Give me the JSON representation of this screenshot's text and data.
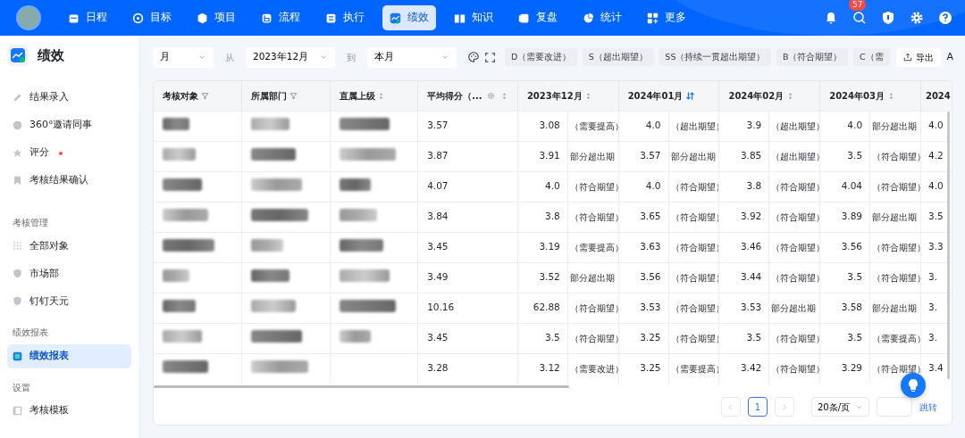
{
  "nav": {
    "items": [
      {
        "label": "日程",
        "selected": false
      },
      {
        "label": "目标",
        "selected": false
      },
      {
        "label": "项目",
        "selected": false
      },
      {
        "label": "流程",
        "selected": false
      },
      {
        "label": "执行",
        "selected": false
      },
      {
        "label": "绩效",
        "selected": true
      },
      {
        "label": "知识",
        "selected": false
      },
      {
        "label": "复盘",
        "selected": false
      },
      {
        "label": "统计",
        "selected": false
      },
      {
        "label": "更多",
        "selected": false
      }
    ],
    "notification_count": "57"
  },
  "sidebar": {
    "title": "绩效",
    "groups": [
      {
        "items": [
          {
            "label": "结果录入",
            "selected": false,
            "dot": false
          },
          {
            "label": "360°邀请同事",
            "selected": false,
            "dot": false
          },
          {
            "label": "评分",
            "selected": false,
            "dot": true
          },
          {
            "label": "考核结果确认",
            "selected": false,
            "dot": false
          }
        ]
      },
      {
        "heading": "考核管理",
        "items": [
          {
            "label": "全部对象",
            "selected": false,
            "dot": false
          },
          {
            "label": "市场部",
            "selected": false,
            "dot": false
          },
          {
            "label": "钉钉天元",
            "selected": false,
            "dot": false
          }
        ]
      },
      {
        "heading": "绩效报表",
        "items": [
          {
            "label": "绩效报表",
            "selected": true,
            "dot": false
          }
        ]
      },
      {
        "heading": "设置",
        "items": [
          {
            "label": "考核模板",
            "selected": false,
            "dot": false
          }
        ]
      }
    ]
  },
  "toolbar": {
    "period": "月",
    "from_label": "从",
    "from": "2023年12月",
    "to_label": "到",
    "to": "本月",
    "legend": [
      "D（需要改进）",
      "S（超出期望）",
      "SS（持续一贯超出期望）",
      "B（符合期望）",
      "C（需"
    ],
    "export": "导出",
    "cut_text": "A"
  },
  "table": {
    "columns": [
      {
        "label": "考核对象",
        "kind": "filter",
        "active": false
      },
      {
        "label": "所属部门",
        "kind": "filter",
        "active": false
      },
      {
        "label": "直属上级",
        "kind": "sort",
        "active": false
      },
      {
        "label": "平均得分（...",
        "kind": "settings",
        "active": false
      },
      {
        "label": "2023年12月",
        "kind": "sort",
        "active": false
      },
      {
        "label": "2024年01月",
        "kind": "sort",
        "active": true
      },
      {
        "label": "2024年02月",
        "kind": "sort",
        "active": false
      },
      {
        "label": "2024年03月",
        "kind": "sort",
        "active": false
      },
      {
        "label": "2024",
        "kind": "plain"
      }
    ],
    "rows": [
      {
        "redacted": [
          true,
          true,
          true
        ],
        "average": "3.57",
        "months": [
          [
            "3.08",
            "（需要提高）"
          ],
          [
            "4.0",
            "（超出期望）"
          ],
          [
            "3.9",
            "（超出期望）"
          ],
          [
            "4.0",
            "部分超出期"
          ]
        ],
        "partial": "4.0"
      },
      {
        "redacted": [
          true,
          true,
          true
        ],
        "average": "3.87",
        "months": [
          [
            "3.91",
            "部分超出期"
          ],
          [
            "3.57",
            "部分超出期"
          ],
          [
            "3.85",
            "（超出期望）"
          ],
          [
            "3.5",
            "（符合期望）"
          ]
        ],
        "partial": "4.2"
      },
      {
        "redacted": [
          true,
          true,
          true
        ],
        "average": "4.07",
        "months": [
          [
            "4.0",
            "（符合期望）"
          ],
          [
            "4.0",
            "（符合期望）"
          ],
          [
            "3.8",
            "（符合期望）"
          ],
          [
            "4.04",
            "（符合期望）"
          ]
        ],
        "partial": "4.0"
      },
      {
        "redacted": [
          true,
          true,
          true
        ],
        "average": "3.84",
        "months": [
          [
            "3.8",
            "（符合期望）"
          ],
          [
            "3.65",
            "（符合期望）"
          ],
          [
            "3.92",
            "（符合期望）"
          ],
          [
            "3.89",
            "部分超出期"
          ]
        ],
        "partial": "3.5"
      },
      {
        "redacted": [
          true,
          true,
          true
        ],
        "average": "3.45",
        "months": [
          [
            "3.19",
            "（需要提高）"
          ],
          [
            "3.63",
            "（符合期望）"
          ],
          [
            "3.46",
            "（符合期望）"
          ],
          [
            "3.56",
            "（符合期望）"
          ]
        ],
        "partial": "3.3"
      },
      {
        "redacted": [
          true,
          true,
          true
        ],
        "average": "3.49",
        "months": [
          [
            "3.52",
            "部分超出期"
          ],
          [
            "3.56",
            "（符合期望）"
          ],
          [
            "3.44",
            "（符合期望）"
          ],
          [
            "3.5",
            "（符合期望）"
          ]
        ],
        "partial": "3."
      },
      {
        "redacted": [
          true,
          true,
          true
        ],
        "average": "10.16",
        "months": [
          [
            "62.88",
            "（符合期望）"
          ],
          [
            "3.53",
            "（符合期望）"
          ],
          [
            "3.53",
            "部分超出期"
          ],
          [
            "3.58",
            "部分超出期"
          ]
        ],
        "partial": "3."
      },
      {
        "redacted": [
          true,
          true,
          true
        ],
        "average": "3.45",
        "months": [
          [
            "3.5",
            "（符合期望）"
          ],
          [
            "3.25",
            "（符合期望）"
          ],
          [
            "3.5",
            "（符合期望）"
          ],
          [
            "3.5",
            "（需要提高）"
          ]
        ],
        "partial": "3."
      },
      {
        "redacted": [
          true,
          true,
          false
        ],
        "average": "3.28",
        "months": [
          [
            "3.12",
            "（需要改进）"
          ],
          [
            "3.25",
            "（需要提高）"
          ],
          [
            "3.42",
            "（符合期望）"
          ],
          [
            "3.29",
            "（符合期望）"
          ]
        ],
        "partial": "3.4"
      }
    ]
  },
  "pagination": {
    "pages": [
      {
        "label": "1",
        "selected": true
      }
    ],
    "page_size": "20条/页",
    "jump": "跳转"
  }
}
